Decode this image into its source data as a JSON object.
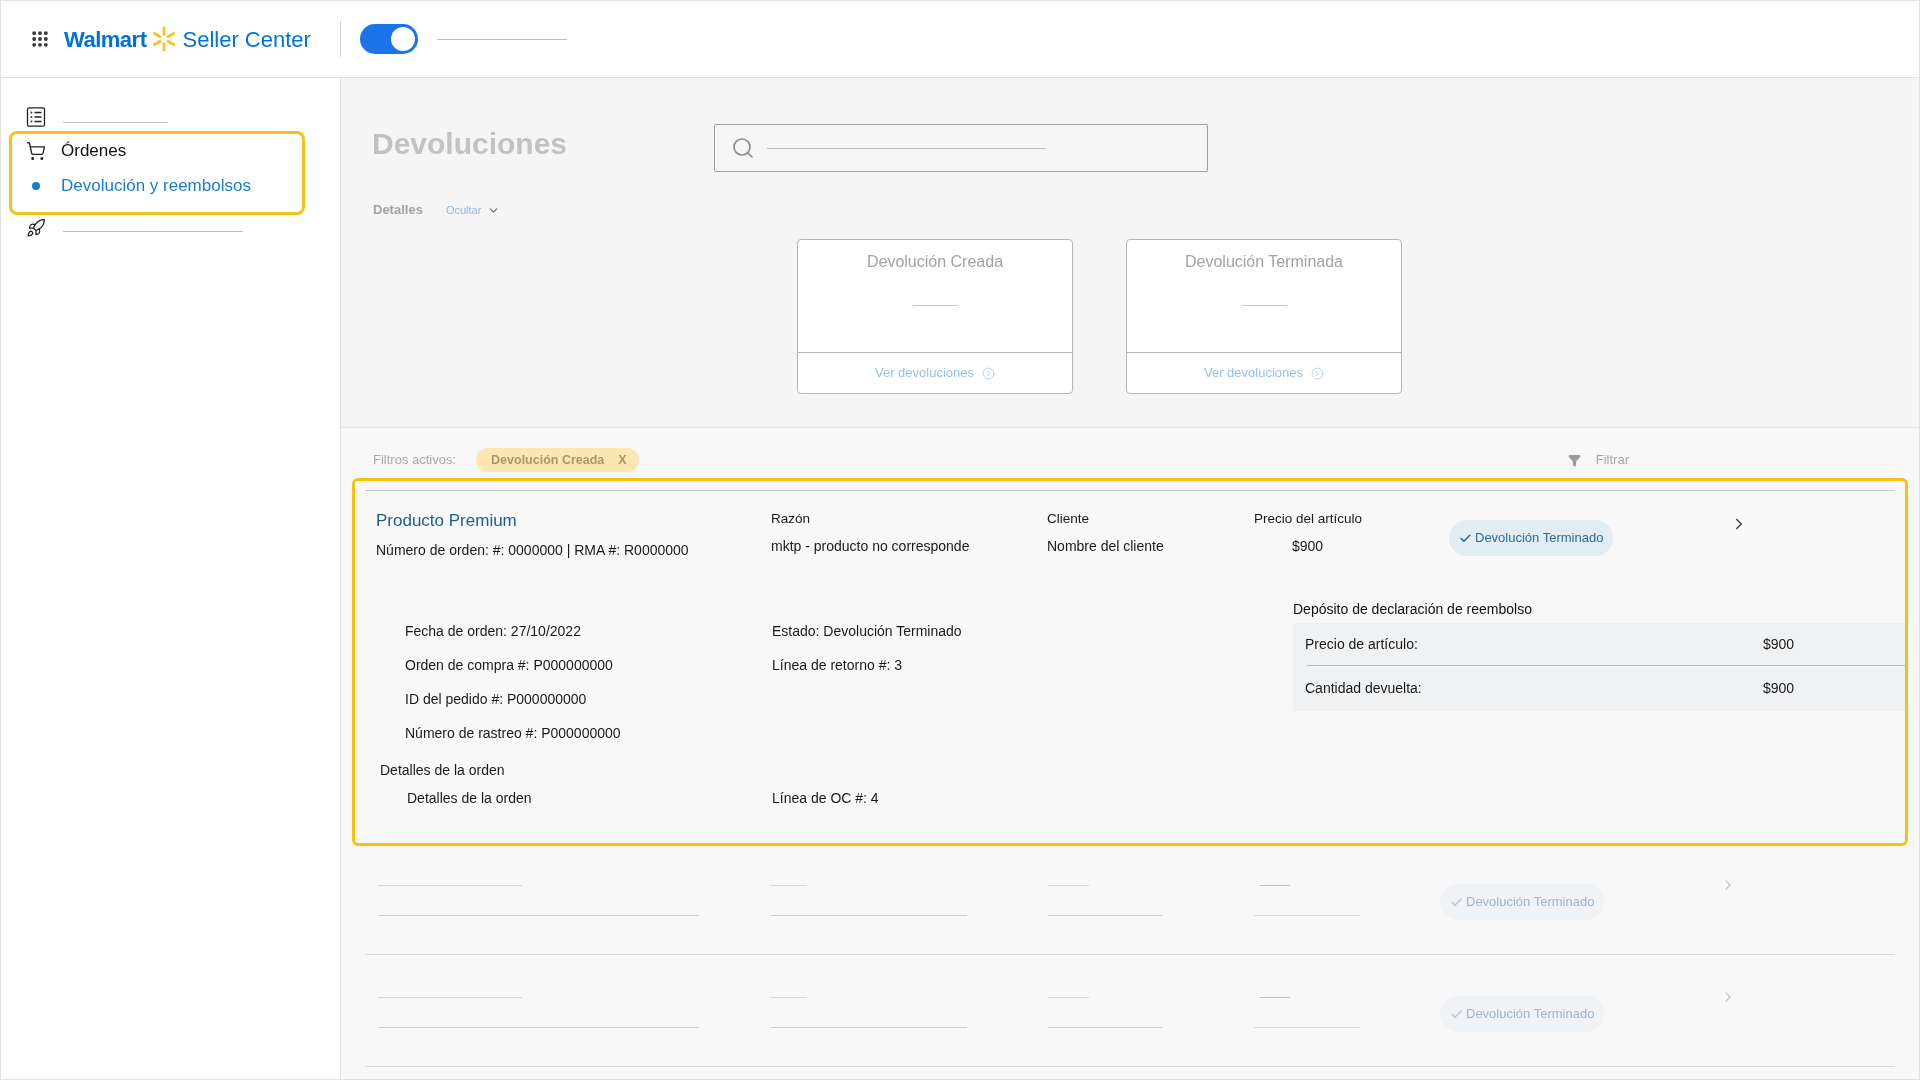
{
  "header": {
    "logo": "Walmart",
    "product": "Seller Center",
    "toggle": {
      "on": true
    }
  },
  "sidebar": {
    "items": [
      {
        "kind": "placeholder",
        "highlighted": false
      },
      {
        "kind": "link",
        "label": "Órdenes",
        "highlighted": true,
        "children": [
          {
            "label": "Devolución y reembolsos",
            "selected": true
          }
        ]
      },
      {
        "kind": "placeholder",
        "highlighted": false
      }
    ]
  },
  "page": {
    "title": "Devoluciones",
    "details": {
      "label": "Detalles",
      "toggle": "Ocultar",
      "expanded": true
    },
    "cards": [
      {
        "title": "Devolución Creada",
        "link": "Ver devoluciones"
      },
      {
        "title": "Devolución Terminada",
        "link": "Ver devoluciones"
      }
    ]
  },
  "filters": {
    "label": "Filtros activos:",
    "chips": [
      {
        "label": "Devolución Creada",
        "remove": "X"
      }
    ],
    "button": "Filtrar"
  },
  "returns": [
    {
      "kind": "detail",
      "highlighted": true,
      "product": "Producto Premium",
      "order_info": "Número de orden: #: 0000000 | RMA #: R0000000",
      "columns": [
        {
          "label": "Razón",
          "value": "mktp - producto no corresponde"
        },
        {
          "label": "Cliente",
          "value": "Nombre del cliente"
        },
        {
          "label": "Precio del artículo",
          "value": "$900"
        }
      ],
      "status": "Devolución Terminado",
      "info_left": [
        "Fecha de orden: 27/10/2022",
        "Orden de compra #: P000000000",
        "ID del pedido #: P000000000",
        "Número de rastreo #: P000000000"
      ],
      "info_right": [
        "Estado: Devolución Terminado",
        "Línea de retorno #: 3"
      ],
      "order_details": {
        "heading": "Detalles de la orden",
        "left": "Detalles de la orden",
        "right": "Línea de OC #: 4"
      },
      "refund": {
        "title": "Depósito de declaración de reembolso",
        "rows": [
          {
            "label": "Precio de artículo:",
            "value": "$900"
          },
          {
            "label": "Cantidad devuelta:",
            "value": "$900"
          }
        ]
      }
    },
    {
      "kind": "skeleton",
      "highlighted": false,
      "status": "Devolución Terminado"
    },
    {
      "kind": "skeleton",
      "highlighted": false,
      "status": "Devolución Terminado"
    }
  ]
}
